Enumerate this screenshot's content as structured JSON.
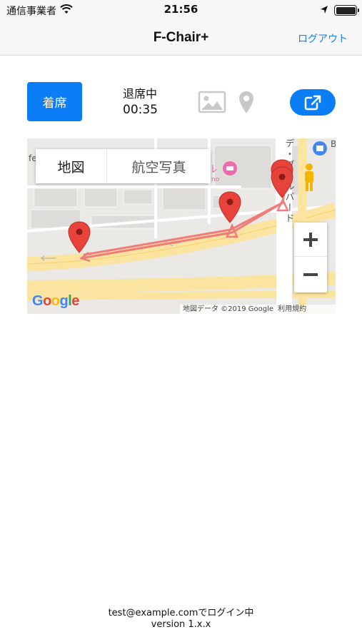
{
  "status_bar": {
    "carrier": "通信事業者",
    "time": "21:56"
  },
  "nav": {
    "title": "F-Chair+",
    "logout_label": "ログアウト"
  },
  "controls": {
    "seat_button_label": "着席",
    "status_text": "退席中",
    "timer": "00:35",
    "accent_color": "#0b7ef6"
  },
  "map": {
    "type_map_label": "地図",
    "type_satellite_label": "航空写真",
    "selected_type": "地図",
    "attribution": "地図データ ©2019 Google",
    "terms": "利用規約",
    "logo": {
      "g1": "G",
      "o1": "o",
      "o2": "o",
      "g2": "g",
      "l": "l",
      "e": "e"
    },
    "street_vertical_text": "デ・ブールバード",
    "route_color": "#f07b78",
    "pin_color": "#e8433a"
  },
  "footer": {
    "login_status": "test@example.comでログイン中",
    "version": "version 1.x.x"
  }
}
